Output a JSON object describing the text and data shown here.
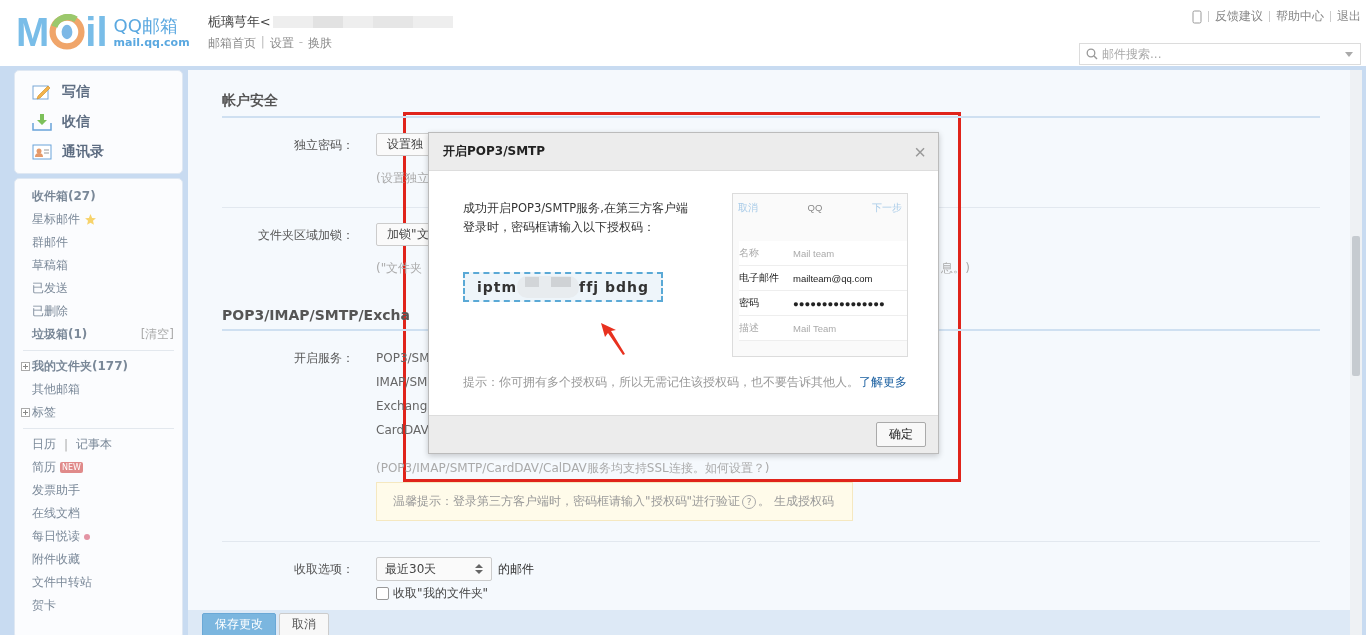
{
  "header": {
    "logo": {
      "left": "M",
      "right": "il",
      "product": "QQ邮箱",
      "domain": "mail.qq.com"
    },
    "user": {
      "name": "栀璃芎年<"
    },
    "nav": [
      {
        "label": "邮箱首页",
        "kind": "link"
      },
      {
        "label": "|",
        "kind": "sep"
      },
      {
        "label": "设置",
        "kind": "link"
      },
      {
        "label": "-",
        "kind": "sep"
      },
      {
        "label": "换肤",
        "kind": "link"
      }
    ],
    "top_links": [
      {
        "label": "反馈建议"
      },
      {
        "label": "帮助中心"
      },
      {
        "label": "退出"
      }
    ],
    "search": {
      "placeholder": "邮件搜索..."
    }
  },
  "sidebar": {
    "actions": [
      {
        "label": "写信",
        "kind": "compose"
      },
      {
        "label": "收信",
        "kind": "receive"
      },
      {
        "label": "通讯录",
        "kind": "contacts"
      }
    ],
    "groups": [
      [
        {
          "label": "收件箱(27)",
          "kind": "bold"
        },
        {
          "label": "星标邮件",
          "kind": "starred"
        },
        {
          "label": "群邮件",
          "kind": "plain"
        },
        {
          "label": "草稿箱",
          "kind": "plain"
        },
        {
          "label": "已发送",
          "kind": "plain"
        },
        {
          "label": "已删除",
          "kind": "plain"
        },
        {
          "label": "垃圾箱(1)",
          "kind": "bold",
          "action": "[清空]"
        }
      ],
      [
        {
          "label": "我的文件夹(177)",
          "kind": "tree-bold"
        },
        {
          "label": "其他邮箱",
          "kind": "plain"
        },
        {
          "label": "标签",
          "kind": "tree"
        }
      ],
      [
        {
          "label": "日历",
          "kind": "pair",
          "second": "记事本",
          "separator": "|"
        },
        {
          "label": "简历",
          "kind": "badge",
          "badge": "NEW"
        },
        {
          "label": "发票助手",
          "kind": "plain"
        },
        {
          "label": "在线文档",
          "kind": "plain"
        },
        {
          "label": "每日悦读",
          "kind": "dot"
        },
        {
          "label": "附件收藏",
          "kind": "plain"
        },
        {
          "label": "文件中转站",
          "kind": "plain"
        },
        {
          "label": "贺卡",
          "kind": "plain"
        }
      ]
    ]
  },
  "settings": {
    "sections": [
      {
        "heading": "帐户安全",
        "rows": [
          {
            "label": "独立密码：",
            "kind": "button",
            "button": "设置独",
            "hint": "(设置独立"
          },
          {
            "label": "文件夹区域加锁：",
            "kind": "button",
            "button": "加锁\"文",
            "hint": "(\"文件夹",
            "hint_tail": "息。)"
          }
        ]
      },
      {
        "heading": "POP3/IMAP/SMTP/Excha",
        "rows": [
          {
            "label": "开启服务：",
            "kind": "services",
            "services": [
              "POP3/SM",
              "IMAP/SM",
              "Exchang",
              "CardDAV"
            ],
            "hint": "(POP3/IMAP/SMTP/CardDAV/CalDAV服务均支持SSL连接。如何设置？)",
            "tip": {
              "text": "温馨提示：登录第三方客户端时，密码框请输入\"授权码\"进行验证",
              "help": "?",
              "after": "。",
              "link": "生成授权码"
            }
          }
        ]
      },
      {
        "rows": [
          {
            "label": "收取选项：",
            "kind": "select",
            "value": "最近30天",
            "suffix": "的邮件",
            "checkbox": {
              "label": "收取\"我的文件夹\"",
              "checked": false
            }
          }
        ]
      }
    ],
    "buttons": [
      {
        "label": "保存更改",
        "primary": true
      },
      {
        "label": "取消",
        "primary": false
      }
    ]
  },
  "dialog": {
    "title": "开启POP3/SMTP",
    "close": "×",
    "message": "成功开启POP3/SMTP服务,在第三方客户端登录时，密码框请输入以下授权码：",
    "code": {
      "start": "iptm",
      "end": "ffj bdhg"
    },
    "preview": {
      "cancel": "取消",
      "title": "QQ",
      "next": "下一步",
      "fields": [
        {
          "label": "名称",
          "value": "Mail team",
          "filled": false
        },
        {
          "label": "电子邮件",
          "value": "mailteam@qq.com",
          "filled": true
        },
        {
          "label": "密码",
          "value": "●●●●●●●●●●●●●●●●",
          "filled": true
        },
        {
          "label": "描述",
          "value": "Mail Team",
          "filled": false
        }
      ]
    },
    "note": "提示：你可拥有多个授权码，所以无需记住该授权码，也不要告诉其他人。",
    "note_link": "了解更多",
    "ok": "确定"
  }
}
